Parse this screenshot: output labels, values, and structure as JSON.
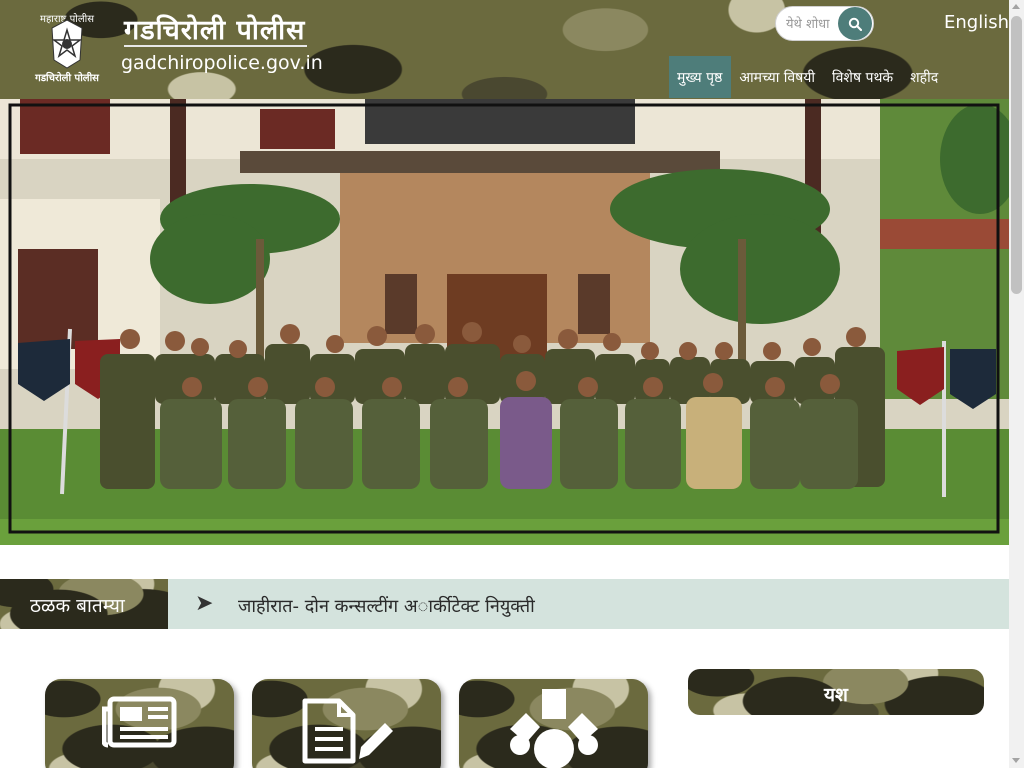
{
  "header": {
    "title": "गडचिरोली पोलीस",
    "url": "gadchiropolice.gov.in",
    "emblem_text_top": "महाराष्ट्र पोलीस",
    "emblem_text_bottom": "गडचिरोली पोलीस"
  },
  "search": {
    "placeholder": "येथे शोधा",
    "icon": "search-icon"
  },
  "language_link": "English",
  "nav": {
    "items": [
      {
        "label": "मुख्य पृष्ठ",
        "active": true
      },
      {
        "label": "आमच्या विषयी",
        "active": false
      },
      {
        "label": "विशेष पथके",
        "active": false
      },
      {
        "label": "शहीद",
        "active": false
      }
    ]
  },
  "ticker": {
    "label": "ठळक बातम्या",
    "items": [
      {
        "text": "जाहीरात- दोन कन्सल्टींग अार्कीटेक्ट नियुक्ती"
      }
    ]
  },
  "cards": [
    {
      "icon": "newspaper-icon"
    },
    {
      "icon": "document-edit-icon"
    },
    {
      "icon": "medal-icon"
    }
  ],
  "fame": {
    "title": "यश"
  },
  "colors": {
    "accent": "#4e7d7a",
    "ticker_bg": "#d4e3dd",
    "camo_dark": "#2b2a1c",
    "camo_mid": "#6b6a3e",
    "camo_light": "#c7c3a4"
  }
}
